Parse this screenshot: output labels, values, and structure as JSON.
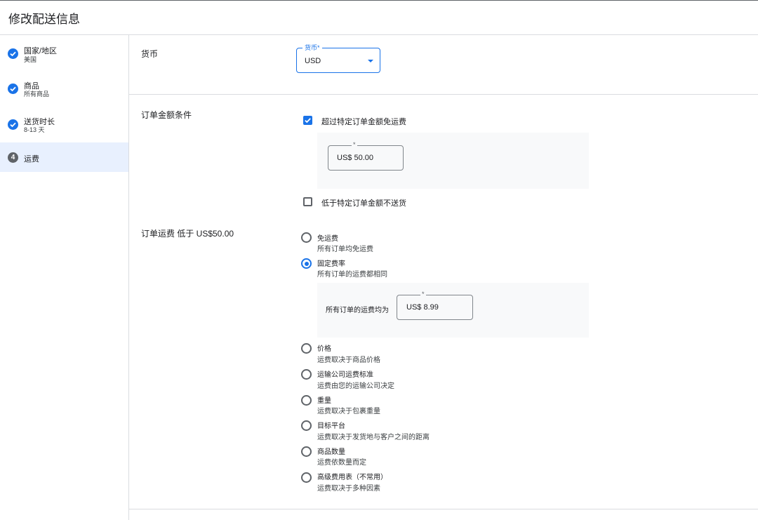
{
  "header": {
    "title": "修改配送信息"
  },
  "sidebar": {
    "steps": [
      {
        "title": "国家/地区",
        "subtitle": "美国",
        "state": "done"
      },
      {
        "title": "商品",
        "subtitle": "所有商品",
        "state": "done"
      },
      {
        "title": "送货时长",
        "subtitle": "8-13 天",
        "state": "done"
      },
      {
        "number": "4",
        "title": "运费",
        "state": "active"
      }
    ]
  },
  "currency": {
    "label": "货币",
    "field_label": "货币*",
    "value": "USD"
  },
  "order_amount": {
    "label": "订单金额条件",
    "free_shipping_checkbox": {
      "label": "超过特定订单金额免运费",
      "checked": true
    },
    "free_shipping_threshold": {
      "required_mark": "*",
      "value": "US$ 50.00"
    },
    "min_order_checkbox": {
      "label": "低于特定订单金额不送货",
      "checked": false
    }
  },
  "shipping_rate": {
    "label": "订单运费 低于 US$50.00",
    "options": [
      {
        "title": "免运费",
        "desc": "所有订单均免运费",
        "selected": false
      },
      {
        "title": "固定费率",
        "desc": "所有订单的运费都相同",
        "selected": true
      },
      {
        "title": "价格",
        "desc": "运费取决于商品价格",
        "selected": false
      },
      {
        "title": "运输公司运费标准",
        "desc": "运费由您的运输公司决定",
        "selected": false
      },
      {
        "title": "重量",
        "desc": "运费取决于包裹重量",
        "selected": false
      },
      {
        "title": "目标平台",
        "desc": "运费取决于发货地与客户之间的距离",
        "selected": false
      },
      {
        "title": "商品数量",
        "desc": "运费依数量而定",
        "selected": false
      },
      {
        "title": "高级费用表（不常用）",
        "desc": "运费取决于多种因素",
        "selected": false
      }
    ],
    "flat_rate": {
      "text": "所有订单的运费均为",
      "required_mark": "*",
      "value": "US$ 8.99"
    }
  },
  "colors": {
    "accent": "#1a73e8",
    "active_bg": "#e8f0fe",
    "divider": "#dadce0",
    "panel_bg": "#f8f9fa"
  }
}
